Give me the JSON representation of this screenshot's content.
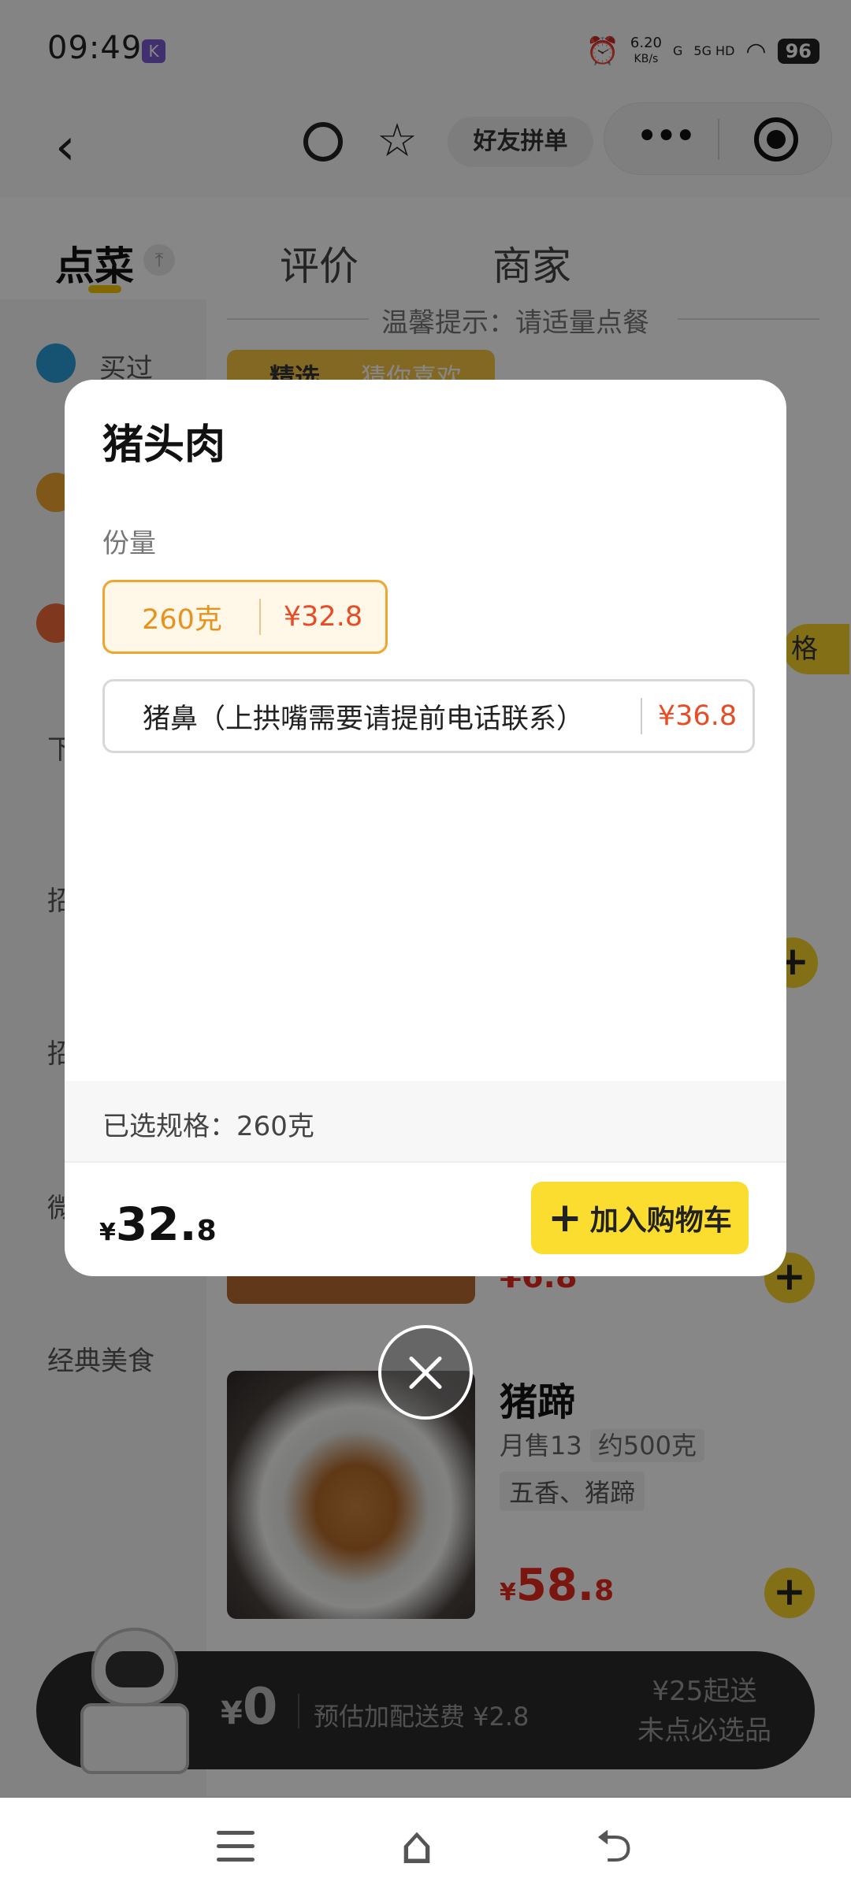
{
  "status_bar": {
    "time": "09:49",
    "app_badge": "K",
    "net_speed_top": "6.20",
    "net_speed_unit": "KB/s",
    "signal_1": "G",
    "signal_2": "5G HD",
    "battery": "96"
  },
  "nav": {
    "friend_group": "好友拼单"
  },
  "tabs": [
    {
      "label": "点菜",
      "active": true
    },
    {
      "label": "评价",
      "active": false
    },
    {
      "label": "商家",
      "active": false
    }
  ],
  "background": {
    "notice": "温馨提示：请适量点餐",
    "sidebar_items": [
      "买过",
      "下",
      "招",
      "招",
      "微",
      "经典美食"
    ],
    "featured": "精选",
    "featured_2": "猜你喜欢",
    "spec_chip": "格",
    "dish": {
      "name": "猪蹄",
      "monthly_sales": "月售13",
      "weight": "约500克",
      "tags": "五香、猪蹄",
      "price_currency": "¥",
      "price_int": "58.",
      "price_dec": "8"
    },
    "prev_price": "¥6.8"
  },
  "modal": {
    "title": "猪头肉",
    "portion_label": "份量",
    "options": [
      {
        "label": "260克",
        "price": "¥32.8",
        "selected": true
      },
      {
        "label": "猪鼻（上拱嘴需要请提前电话联系）",
        "price": "¥36.8",
        "selected": false
      }
    ],
    "selected_spec": "已选规格：260克",
    "price_currency": "¥",
    "price_int": "32.",
    "price_dec": "8",
    "add_to_cart": "加入购物车"
  },
  "cart": {
    "currency": "¥",
    "amount": "0",
    "delivery_fee": "预估加配送费 ¥2.8",
    "min_order": "¥25起送",
    "required": "未点必选品"
  },
  "colors": {
    "accent_yellow": "#fbdd30",
    "price_red": "#e84c25",
    "selected_orange": "#f0a530"
  }
}
